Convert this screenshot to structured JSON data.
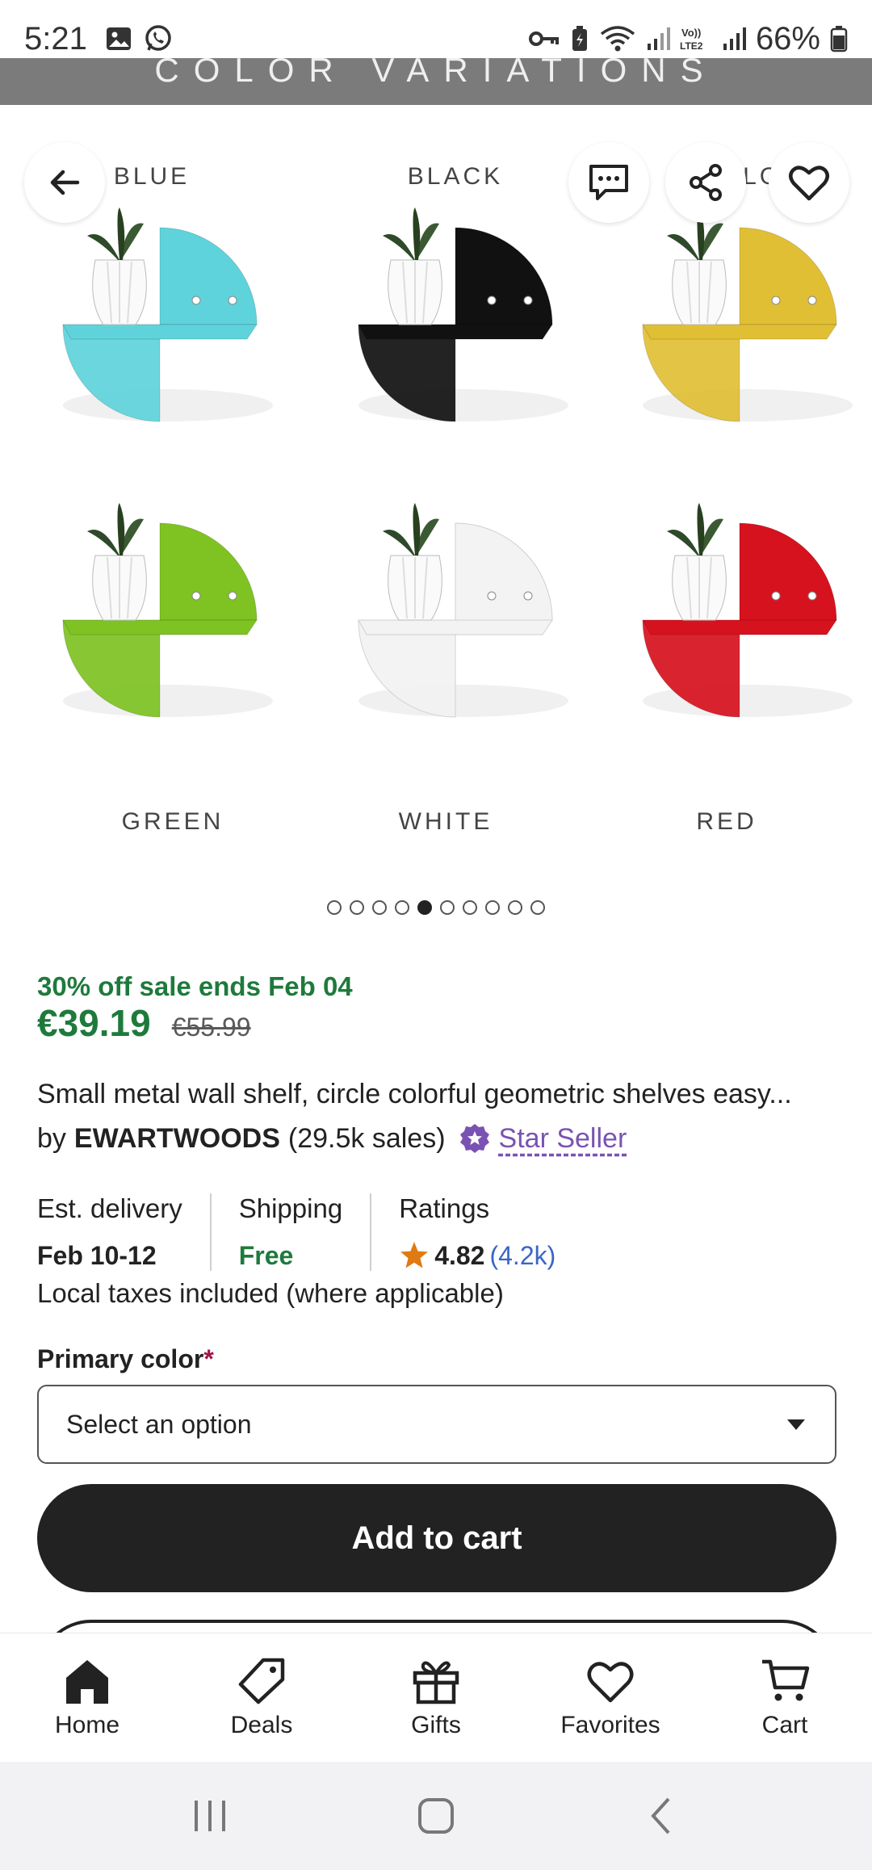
{
  "status_bar": {
    "time": "5:21",
    "battery": "66%"
  },
  "gallery": {
    "banner_text": "COLOR VARIATIONS",
    "top_labels": [
      "BLUE",
      "BLACK",
      "YELLOW"
    ],
    "bottom_labels": [
      "GREEN",
      "WHITE",
      "RED"
    ],
    "shelf_colors": [
      "#5fd3db",
      "#111111",
      "#e1bf35",
      "#7ec322",
      "#f3f3f3",
      "#d6121e"
    ],
    "active_dot": 5,
    "dot_count": 10
  },
  "listing": {
    "sale_text": "30% off sale ends Feb 04",
    "price": "€39.19",
    "original_price": "€55.99",
    "title": "Small metal wall shelf, circle colorful geometric shelves easy...",
    "seller_prefix": "by",
    "seller_name": "EWARTWOODS",
    "seller_sales": "(29.5k sales)",
    "star_seller_label": "Star Seller"
  },
  "info": {
    "delivery_label": "Est. delivery",
    "delivery_value": "Feb 10-12",
    "shipping_label": "Shipping",
    "shipping_value": "Free",
    "ratings_label": "Ratings",
    "rating_value": "4.82",
    "rating_count": "(4.2k)",
    "taxes_note": "Local taxes included (where applicable)"
  },
  "options": {
    "primary_color_label": "Primary color",
    "required_mark": "*",
    "select_placeholder": "Select an option"
  },
  "actions": {
    "add_to_cart": "Add to cart"
  },
  "bottom_nav": {
    "home": "Home",
    "deals": "Deals",
    "gifts": "Gifts",
    "favorites": "Favorites",
    "cart": "Cart"
  },
  "colors": {
    "sale_green": "#1e7a3c",
    "star_purple": "#7a52b3",
    "link_blue": "#3b66c4",
    "star_orange": "#e07a12"
  }
}
